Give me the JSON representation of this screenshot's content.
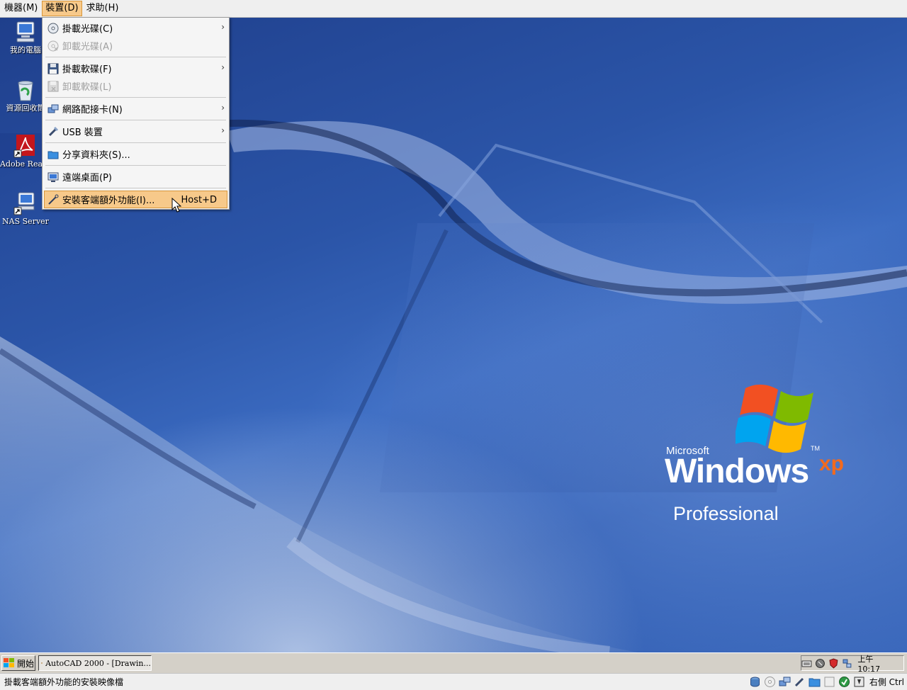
{
  "menubar": {
    "items": [
      "機器(M)",
      "裝置(D)",
      "求助(H)"
    ]
  },
  "desktop": {
    "icons": [
      {
        "label": "我的電腦"
      },
      {
        "label": "資源回收筒"
      },
      {
        "label": "Adobe Reader 8"
      },
      {
        "label": "NAS Server"
      }
    ],
    "logo": {
      "microsoft": "Microsoft",
      "windows": "Windows",
      "xp": "xp",
      "tm": "TM",
      "edition": "Professional"
    }
  },
  "devices_menu": {
    "items": [
      {
        "label": "掛載光碟(C)",
        "icon": "cd-icon",
        "submenu": true,
        "enabled": true
      },
      {
        "label": "卸載光碟(A)",
        "icon": "cd-eject-icon",
        "submenu": false,
        "enabled": false
      },
      {
        "label": "掛載軟碟(F)",
        "icon": "floppy-icon",
        "submenu": true,
        "enabled": true
      },
      {
        "label": "卸載軟碟(L)",
        "icon": "floppy-eject-icon",
        "submenu": false,
        "enabled": false
      },
      {
        "label": "網路配接卡(N)",
        "icon": "network-icon",
        "submenu": true,
        "enabled": true
      },
      {
        "label": "USB 裝置",
        "icon": "usb-icon",
        "submenu": true,
        "enabled": true
      },
      {
        "label": "分享資料夾(S)...",
        "icon": "folder-icon",
        "submenu": false,
        "enabled": true
      },
      {
        "label": "遠端桌面(P)",
        "icon": "remote-desktop-icon",
        "submenu": false,
        "enabled": true
      },
      {
        "label": "安裝客端額外功能(I)...",
        "icon": "guest-additions-icon",
        "submenu": false,
        "enabled": true,
        "shortcut": "Host+D",
        "highlighted": true
      }
    ],
    "more_label": "›"
  },
  "taskbar": {
    "start_label": "開始",
    "task_label": "AutoCAD 2000 - [Drawin...",
    "clock": "上午 10:17"
  },
  "statusbar": {
    "text": "掛載客端額外功能的安裝映像檔",
    "host_key": "右側 Ctrl"
  },
  "colors": {
    "menu_highlight": "#f7c98a",
    "menu_highlight_border": "#d8963a",
    "desktop_blue": "#2b55a8"
  }
}
